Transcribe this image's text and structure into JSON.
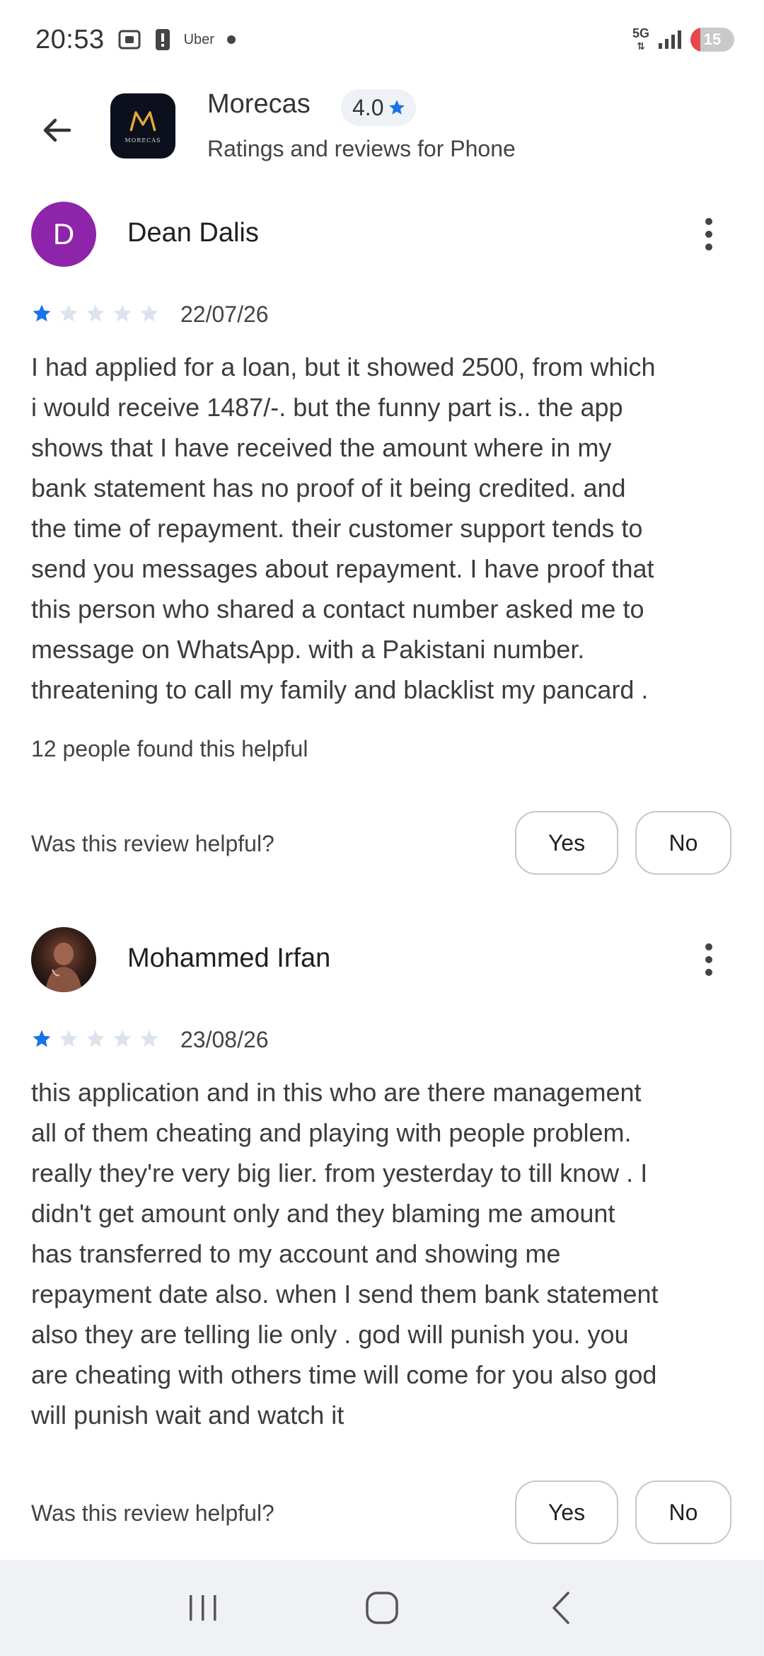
{
  "status_bar": {
    "time": "20:53",
    "notification_app": "Uber",
    "network": "5G",
    "battery": "15"
  },
  "header": {
    "app_name": "Morecas",
    "rating": "4.0",
    "subtitle": "Ratings and reviews for Phone",
    "logo_text": "MORECAS"
  },
  "reviews": [
    {
      "avatar_letter": "D",
      "avatar_color": "#8e24aa",
      "name": "Dean Dalis",
      "stars": 1,
      "date": "22/07/26",
      "text_lines": [
        "I had applied for a loan, but it showed 2500, from which",
        "i would receive 1487/-. but the funny part is.. the app",
        "shows that I have received the amount where in my",
        "bank statement has no proof of it being credited. and",
        "the time of repayment. their customer support tends to",
        "send you messages about repayment. I have proof that",
        "this person who shared a contact number asked me to",
        "message on WhatsApp. with a Pakistani number.",
        "threatening to call my family and blacklist my pancard ."
      ],
      "helpful_count": "12 people found this helpful",
      "helpful_question": "Was this review helpful?",
      "yes_label": "Yes",
      "no_label": "No"
    },
    {
      "name": "Mohammed Irfan",
      "stars": 1,
      "date": "23/08/26",
      "text_lines": [
        "this application and in this who are there management",
        "all of them cheating and playing with people problem.",
        "really they're very big lier. from yesterday to till know . I",
        "didn't get amount only and they blaming me amount",
        "has transferred to my account and showing me",
        "repayment date also. when I send them bank statement",
        "also they are telling lie only . god will punish you. you",
        "are cheating with others time will come for you also god",
        "will punish wait and watch it"
      ],
      "helpful_question": "Was this review helpful?",
      "yes_label": "Yes",
      "no_label": "No"
    }
  ],
  "colors": {
    "star_filled": "#1a73e8",
    "star_empty": "#dde3ee",
    "nav_bar_bg": "#eff1f5"
  }
}
